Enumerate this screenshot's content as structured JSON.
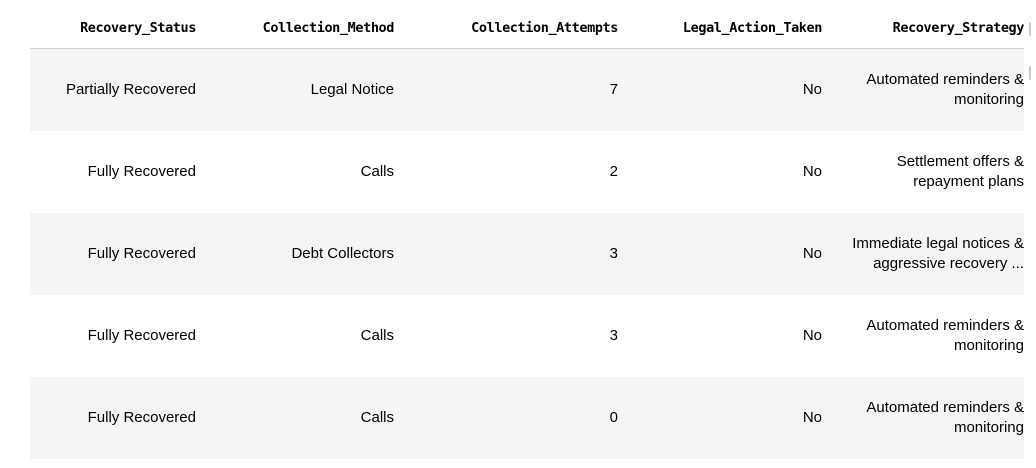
{
  "table": {
    "columns": [
      "Recovery_Status",
      "Collection_Method",
      "Collection_Attempts",
      "Legal_Action_Taken",
      "Recovery_Strategy"
    ],
    "rows": [
      [
        "Partially Recovered",
        "Legal Notice",
        "7",
        "No",
        "Automated reminders & monitoring"
      ],
      [
        "Fully Recovered",
        "Calls",
        "2",
        "No",
        "Settlement offers & repayment plans"
      ],
      [
        "Fully Recovered",
        "Debt Collectors",
        "3",
        "No",
        "Immediate legal notices & aggressive recovery ..."
      ],
      [
        "Fully Recovered",
        "Calls",
        "3",
        "No",
        "Automated reminders & monitoring"
      ],
      [
        "Fully Recovered",
        "Calls",
        "0",
        "No",
        "Automated reminders & monitoring"
      ]
    ]
  },
  "colors": {
    "stripe": "#f5f5f5",
    "header_rule": "#d0d0d0"
  }
}
